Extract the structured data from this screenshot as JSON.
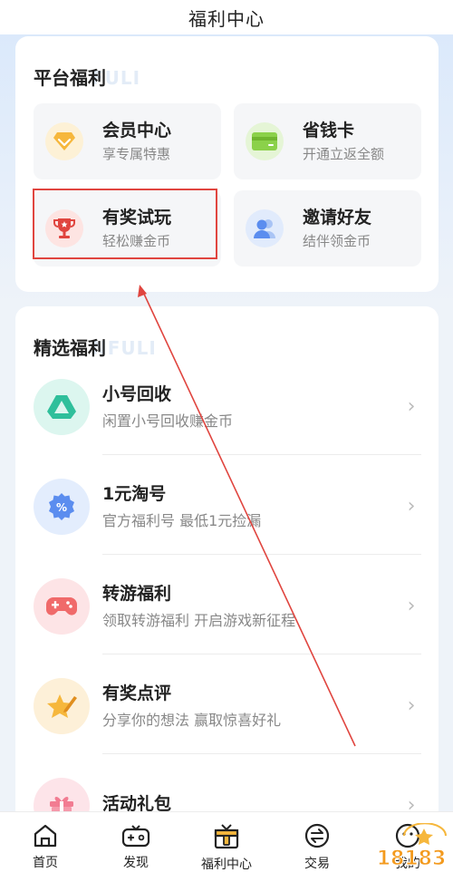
{
  "header": {
    "title": "福利中心"
  },
  "platform": {
    "title": "平台福利",
    "watermark": "FULI",
    "tiles": [
      {
        "name": "会员中心",
        "desc": "享专属特惠",
        "icon": "diamond-icon"
      },
      {
        "name": "省钱卡",
        "desc": "开通立返全额",
        "icon": "card-icon"
      },
      {
        "name": "有奖试玩",
        "desc": "轻松赚金币",
        "icon": "trophy-icon"
      },
      {
        "name": "邀请好友",
        "desc": "结伴领金币",
        "icon": "users-icon"
      }
    ]
  },
  "featured": {
    "title": "精选福利",
    "watermark": "NFULI",
    "items": [
      {
        "name": "小号回收",
        "desc": "闲置小号回收赚金币",
        "icon": "recycle-triangle-icon"
      },
      {
        "name": "1元淘号",
        "desc": "官方福利号 最低1元捡漏",
        "icon": "discount-badge-icon"
      },
      {
        "name": "转游福利",
        "desc": "领取转游福利 开启游戏新征程",
        "icon": "gamepad-icon"
      },
      {
        "name": "有奖点评",
        "desc": "分享你的想法 赢取惊喜好礼",
        "icon": "star-pen-icon"
      },
      {
        "name": "活动礼包",
        "desc": "",
        "icon": "gift-icon"
      }
    ]
  },
  "nav": {
    "items": [
      {
        "label": "首页",
        "icon": "home-icon"
      },
      {
        "label": "发现",
        "icon": "gamepad-nav-icon"
      },
      {
        "label": "福利中心",
        "icon": "gift-box-nav-icon"
      },
      {
        "label": "交易",
        "icon": "exchange-icon"
      },
      {
        "label": "我的",
        "icon": "profile-icon"
      }
    ]
  },
  "watermark_logo": {
    "text": "18183"
  },
  "colors": {
    "accent_red": "#e0453f",
    "gold": "#f6b73c",
    "green": "#8bd14a",
    "blue": "#5b8def",
    "teal": "#2fbf9b",
    "pink": "#f06a6a"
  }
}
